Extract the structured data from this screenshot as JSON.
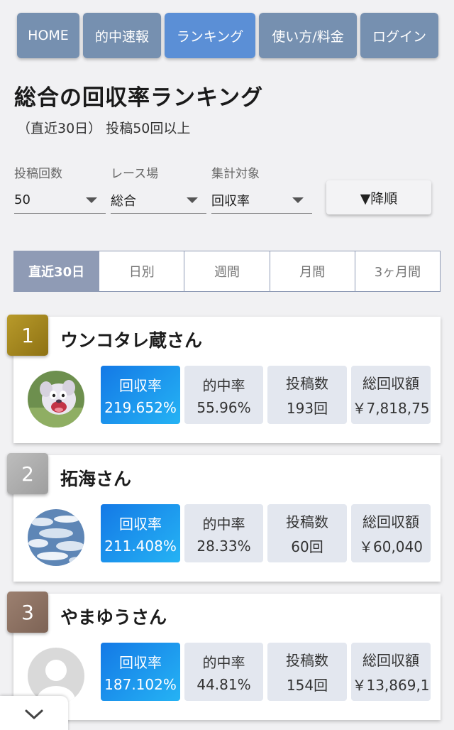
{
  "nav": [
    "HOME",
    "的中速報",
    "ランキング",
    "使い方/料金",
    "ログイン"
  ],
  "page": {
    "title": "総合の回収率ランキング",
    "subtitle": "（直近30日） 投稿50回以上"
  },
  "filters": {
    "post_count": {
      "label": "投稿回数",
      "value": "50"
    },
    "venue": {
      "label": "レース場",
      "value": "総合"
    },
    "target": {
      "label": "集計対象",
      "value": "回収率"
    },
    "sort_label": "▼降順"
  },
  "period_tabs": [
    "直近30日",
    "日別",
    "週間",
    "月間",
    "3ヶ月間"
  ],
  "period_selected": "直近30日",
  "stat_labels": {
    "return_rate": "回収率",
    "hit_rate": "的中率",
    "posts": "投稿数",
    "total_return": "総回収額"
  },
  "rankings": [
    {
      "rank": "1",
      "name": "ウンコタレ蔵さん",
      "return_rate": "219.652%",
      "hit_rate": "55.96%",
      "posts": "193回",
      "total_return": "￥7,818,75",
      "badge_color": "#a8891f",
      "avatar": "cartoon-character"
    },
    {
      "rank": "2",
      "name": "拓海さん",
      "return_rate": "211.408%",
      "hit_rate": "28.33%",
      "posts": "60回",
      "total_return": "￥60,040",
      "badge_color": "#adadad",
      "avatar": "sky-photo"
    },
    {
      "rank": "3",
      "name": "やまゆうさん",
      "return_rate": "187.102%",
      "hit_rate": "44.81%",
      "posts": "154回",
      "total_return": "￥13,869,1",
      "badge_color": "#8c7263",
      "avatar": "default-user"
    }
  ],
  "colors": {
    "nav": "#7690b0",
    "nav_active": "#5b8fd6",
    "tab_active": "#8f9bb5",
    "primary_stat": "#1479e6"
  }
}
